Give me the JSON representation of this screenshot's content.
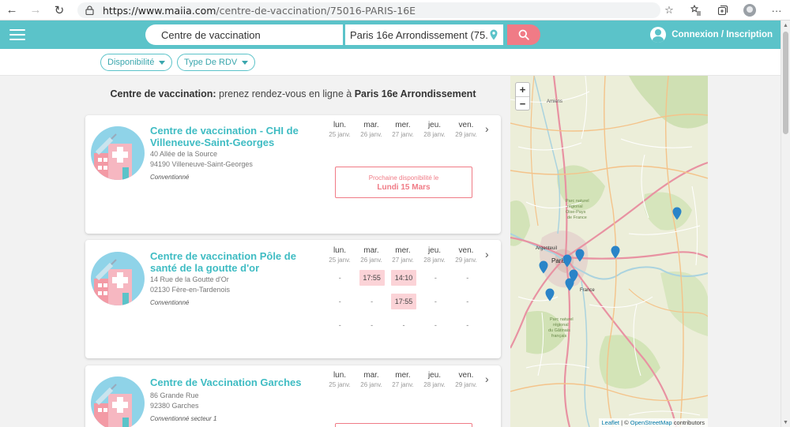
{
  "browser": {
    "url_host": "https://www.maiia.com",
    "url_path": "/centre-de-vaccination/75016-PARIS-16E"
  },
  "header": {
    "specialty_value": "Centre de vaccination",
    "location_value": "Paris 16e Arrondissement (75...",
    "login_label": "Connexion / Inscription",
    "accent_color": "#5bc3c9",
    "search_button_color": "#f07b86"
  },
  "filters": {
    "availability": "Disponibilité",
    "appointment_type": "Type De RDV"
  },
  "headline": {
    "prefix": "Centre de vaccination:",
    "middle": " prenez rendez-vous en ligne à ",
    "place": "Paris 16e Arrondissement"
  },
  "days": [
    {
      "name": "lun.",
      "date": "25 janv."
    },
    {
      "name": "mar.",
      "date": "26 janv."
    },
    {
      "name": "mer.",
      "date": "27 janv."
    },
    {
      "name": "jeu.",
      "date": "28 janv."
    },
    {
      "name": "ven.",
      "date": "29 janv."
    }
  ],
  "centers": [
    {
      "name": "Centre de vaccination - CHI de Villeneuve-Saint-Georges",
      "address_line1": "40 Allée de la Source",
      "address_line2": "94190 Villeneuve-Saint-Georges",
      "convention": "Conventionné",
      "next_availability_label": "Prochaine disponibilité le",
      "next_availability_date": "Lundi 15 Mars"
    },
    {
      "name": "Centre de vaccination Pôle de santé de la goutte d'or",
      "address_line1": "14 Rue de la Goutte d'Or",
      "address_line2": "02130 Fère-en-Tardenois",
      "convention": "Conventionné",
      "slots": [
        [
          "-",
          "17:55",
          "14:10",
          "-",
          "-"
        ],
        [
          "-",
          "-",
          "17:55",
          "-",
          "-"
        ],
        [
          "-",
          "-",
          "-",
          "-",
          "-"
        ]
      ]
    },
    {
      "name": "Centre de Vaccination Garches",
      "address_line1": "86 Grande Rue",
      "address_line2": "92380 Garches",
      "convention": "Conventionné secteur 1"
    }
  ],
  "map": {
    "zoom_in": "+",
    "zoom_out": "−",
    "attribution_leaflet": "Leaflet",
    "attribution_sep": " | © ",
    "attribution_osm": "OpenStreetMap",
    "attribution_suffix": " contributors",
    "marker_color": "#2a84c8",
    "labels": {
      "amiens": "Amiens",
      "parc_l1": "Parc naturel",
      "parc_l2": "régional",
      "parc_l3": "Oise-Pays",
      "parc_l4": "de France",
      "argenteuil": "Argenteuil",
      "paris": "Paris",
      "france": "France",
      "gat_l1": "Parc naturel",
      "gat_l2": "régional",
      "gat_l3": "du Gâtinais",
      "gat_l4": "français"
    }
  }
}
